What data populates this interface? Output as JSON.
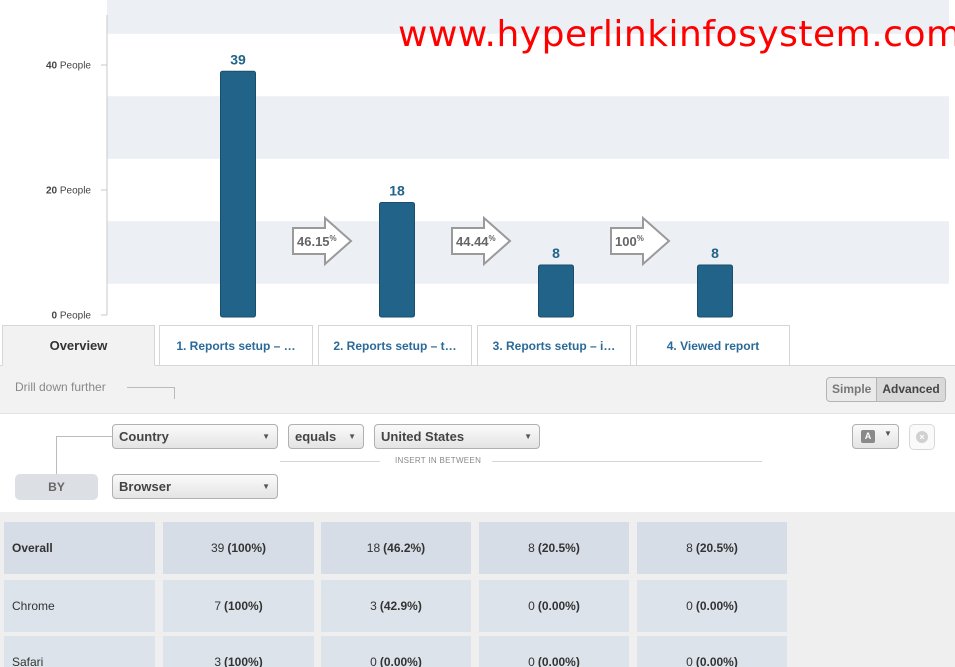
{
  "watermark": "www.hyperlinkinfosystem.com",
  "chart_data": {
    "type": "bar",
    "title": "",
    "xlabel": "",
    "ylabel": "",
    "ylim": [
      0,
      48
    ],
    "y_unit": "People",
    "yticks": [
      0,
      20,
      40
    ],
    "ytick_labels": [
      "0 People",
      "20 People",
      "40 People"
    ],
    "categories": [
      "1. Reports setup – …",
      "2. Reports setup – t…",
      "3. Reports setup – i…",
      "4. Viewed report"
    ],
    "values": [
      39,
      18,
      8,
      8
    ],
    "data_labels": [
      "39",
      "18",
      "8",
      "8"
    ],
    "conversion_rates": [
      "46.15%",
      "44.44%",
      "100%"
    ],
    "banded_background": true,
    "colors": {
      "bar": "#226389",
      "band": "#eceff4",
      "arrow_stroke": "#9a9a9a"
    }
  },
  "tabs": [
    {
      "label": "Overview",
      "active": true
    },
    {
      "label": "1. Reports setup – …",
      "active": false
    },
    {
      "label": "2. Reports setup – t…",
      "active": false
    },
    {
      "label": "3. Reports setup – i…",
      "active": false
    },
    {
      "label": "4. Viewed report",
      "active": false
    }
  ],
  "drilldown": {
    "label": "Drill down further",
    "mode_simple": "Simple",
    "mode_advanced": "Advanced",
    "mode_selected": "Advanced"
  },
  "filters": {
    "property": "Country",
    "operator": "equals",
    "value": "United States",
    "insert_label": "INSERT IN BETWEEN",
    "by_label": "BY",
    "by_property": "Browser",
    "type_button": "A"
  },
  "table": {
    "rows": [
      {
        "name": "Overall",
        "cells": [
          [
            "39",
            "(100%)"
          ],
          [
            "18",
            "(46.2%)"
          ],
          [
            "8",
            "(20.5%)"
          ],
          [
            "8",
            "(20.5%)"
          ]
        ]
      },
      {
        "name": "Chrome",
        "cells": [
          [
            "7",
            "(100%)"
          ],
          [
            "3",
            "(42.9%)"
          ],
          [
            "0",
            "(0.00%)"
          ],
          [
            "0",
            "(0.00%)"
          ]
        ]
      },
      {
        "name": "Safari",
        "cells": [
          [
            "3",
            "(100%)"
          ],
          [
            "0",
            "(0.00%)"
          ],
          [
            "0",
            "(0.00%)"
          ],
          [
            "0",
            "(0.00%)"
          ]
        ]
      }
    ]
  },
  "icons": {
    "caret": "chevron-down-icon",
    "close": "close-icon",
    "arrow": "conversion-arrow-icon"
  }
}
